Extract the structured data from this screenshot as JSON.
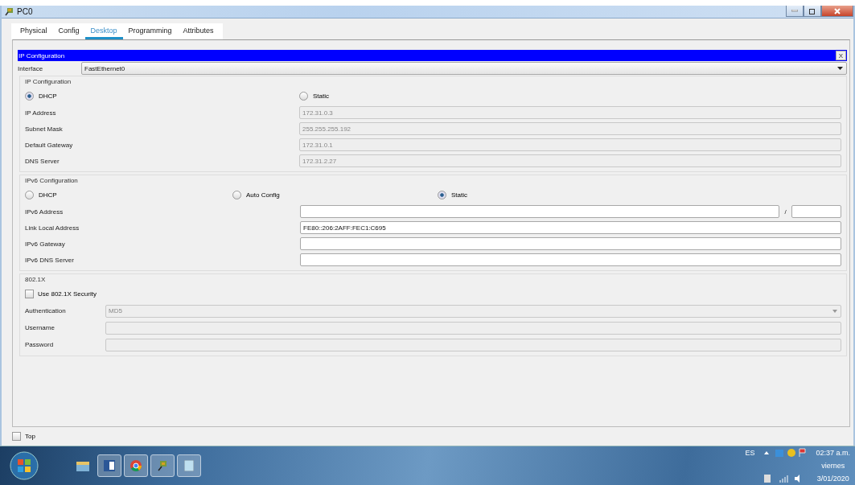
{
  "window": {
    "title": "PC0"
  },
  "tabs": [
    {
      "label": "Physical",
      "selected": false
    },
    {
      "label": "Config",
      "selected": false
    },
    {
      "label": "Desktop",
      "selected": true
    },
    {
      "label": "Programming",
      "selected": false
    },
    {
      "label": "Attributes",
      "selected": false
    }
  ],
  "panel": {
    "title": "IP Configuration",
    "close": "X"
  },
  "interface": {
    "label": "Interface",
    "value": "FastEthernet0"
  },
  "ip_config": {
    "title": "IP Configuration",
    "modes": [
      {
        "label": "DHCP",
        "selected": true
      },
      {
        "label": "Static",
        "selected": false
      }
    ],
    "fields": [
      {
        "label": "IP Address",
        "value": "172.31.0.3",
        "disabled": true
      },
      {
        "label": "Subnet Mask",
        "value": "255.255.255.192",
        "disabled": true
      },
      {
        "label": "Default Gateway",
        "value": "172.31.0.1",
        "disabled": true
      },
      {
        "label": "DNS Server",
        "value": "172.31.2.27",
        "disabled": true
      }
    ]
  },
  "ipv6_config": {
    "title": "IPv6 Configuration",
    "modes": [
      {
        "label": "DHCP",
        "selected": false
      },
      {
        "label": "Auto Config",
        "selected": false
      },
      {
        "label": "Static",
        "selected": true
      }
    ],
    "fields": [
      {
        "label": "IPv6 Address",
        "disabled": false,
        "separator": "/"
      },
      {
        "label": "Link Local Address",
        "value": "FE80::206:2AFF:FEC1:C695",
        "disabled": false
      },
      {
        "label": "IPv6 Gateway",
        "disabled": false
      },
      {
        "label": "IPv6 DNS Server",
        "disabled": false
      }
    ]
  },
  "dot1x": {
    "title": "802.1X",
    "security": {
      "label": "Use 802.1X Security",
      "checked": false
    },
    "fields": [
      {
        "kind": "select",
        "label": "Authentication",
        "value": "MD5",
        "disabled": true
      },
      {
        "kind": "text",
        "label": "Username",
        "disabled": true
      },
      {
        "kind": "text",
        "label": "Password",
        "disabled": true
      }
    ]
  },
  "top": {
    "label": "Top",
    "checked": false
  },
  "taskbar": {
    "language": "ES",
    "time": "02:37 a.m.",
    "day": "viernes",
    "date": "3/01/2020"
  }
}
